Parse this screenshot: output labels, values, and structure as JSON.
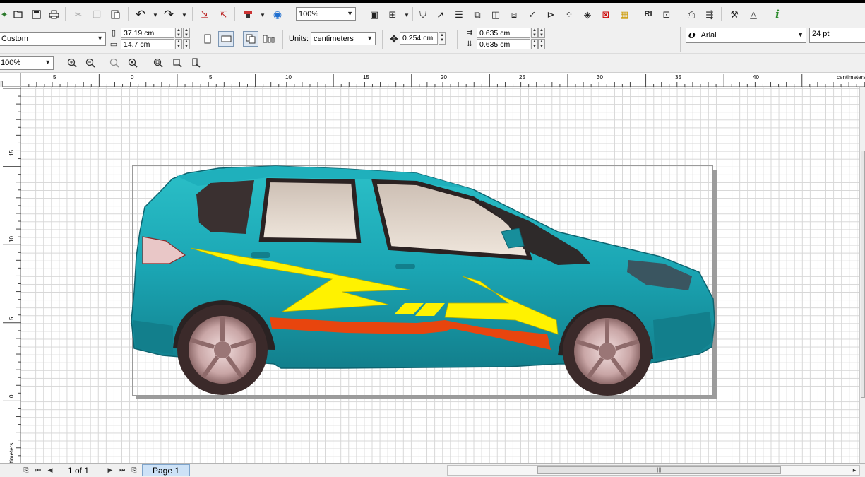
{
  "toolbar_standard": {
    "icons": [
      "new-icon",
      "open-icon",
      "save-icon",
      "print-icon",
      "cut-icon",
      "copy-icon",
      "paste-icon",
      "undo-icon",
      "redo-icon",
      "import-icon",
      "export-icon",
      "launcher-icon",
      "web-icon"
    ],
    "zoom_value": "100%"
  },
  "property_bar": {
    "page_size": "Custom",
    "width": "37.19 cm",
    "height": "14.7 cm",
    "units_label": "Units:",
    "units_value": "centimeters",
    "nudge": "0.254 cm",
    "dup_x": "0.635 cm",
    "dup_y": "0.635 cm",
    "font_name": "Arial",
    "font_size": "24 pt"
  },
  "zoom_bar": {
    "zoom_value": "100%"
  },
  "rulers": {
    "horizontal_labels": [
      "5",
      "0",
      "5",
      "10",
      "15",
      "20",
      "25",
      "30",
      "35",
      "40"
    ],
    "horizontal_unit": "centimeters",
    "vertical_labels": [
      "15",
      "10",
      "5",
      "0"
    ],
    "vertical_unit": "centimeters"
  },
  "status": {
    "page_count": "1 of 1",
    "page_tab": "Page 1"
  },
  "colors": {
    "car_body": "#1ba6b4",
    "stripe_yellow": "#fff200",
    "stripe_orange": "#e8450e",
    "toolbar_bg": "#f0f0f0",
    "page_tab": "#cde2f7"
  }
}
